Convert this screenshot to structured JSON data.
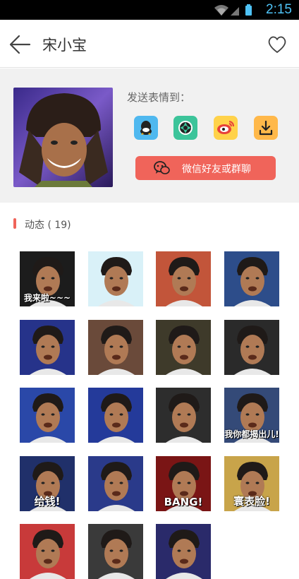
{
  "status": {
    "time": "2:15"
  },
  "header": {
    "title": "宋小宝"
  },
  "send": {
    "label": "发送表情到：",
    "wechat_label": "微信好友或群聊",
    "targets": [
      {
        "icon": "qq-icon",
        "color": "#4fb8ef"
      },
      {
        "icon": "moments-icon",
        "color": "#3cc49a"
      },
      {
        "icon": "weibo-icon",
        "color": "#ffd24a"
      },
      {
        "icon": "download-icon",
        "color": "#ffb84a"
      }
    ]
  },
  "section": {
    "label": "动态 ( 19)"
  },
  "stickers": [
    {
      "caption": "我来啦~~~",
      "bg": "#1c1c1c"
    },
    {
      "caption": "",
      "bg": "#d9f1f8"
    },
    {
      "caption": "",
      "bg": "#c2553a"
    },
    {
      "caption": "",
      "bg": "#2d4d8a"
    },
    {
      "caption": "",
      "bg": "#26338a"
    },
    {
      "caption": "",
      "bg": "#6a4a3a"
    },
    {
      "caption": "",
      "bg": "#3e3a2a"
    },
    {
      "caption": "",
      "bg": "#2a2a2a"
    },
    {
      "caption": "",
      "bg": "#2a48a8"
    },
    {
      "caption": "",
      "bg": "#243a9a"
    },
    {
      "caption": "",
      "bg": "#2d2d2d"
    },
    {
      "caption": "我你都揭出儿!",
      "bg": "#344a78"
    },
    {
      "caption": "给钱!",
      "bg": "#20306a"
    },
    {
      "caption": "",
      "bg": "#2a3a8a"
    },
    {
      "caption": "BANG!",
      "bg": "#7a1515"
    },
    {
      "caption": "寰表脸!",
      "bg": "#c8a44a"
    },
    {
      "caption": "",
      "bg": "#c83a3a"
    },
    {
      "caption": "",
      "bg": "#3a3a3a"
    },
    {
      "caption": "",
      "bg": "#2a2a6a"
    }
  ]
}
